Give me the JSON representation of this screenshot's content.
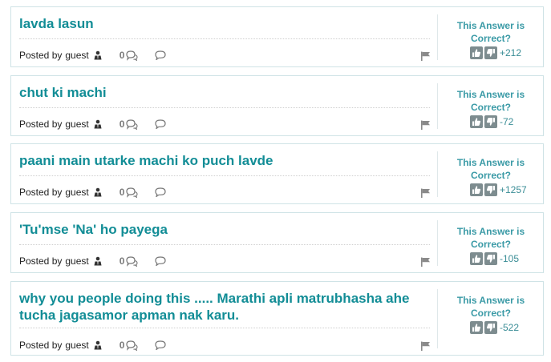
{
  "answers": [
    {
      "text": "lavda lasun",
      "posted_by": "Posted by",
      "author": "guest",
      "comments": "0",
      "vote_prompt": "This Answer is Correct?",
      "score": "+212"
    },
    {
      "text": "chut ki machi",
      "posted_by": "Posted by",
      "author": "guest",
      "comments": "0",
      "vote_prompt": "This Answer is Correct?",
      "score": "-72"
    },
    {
      "text": "paani main utarke machi ko puch lavde",
      "posted_by": "Posted by",
      "author": "guest",
      "comments": "0",
      "vote_prompt": "This Answer is Correct?",
      "score": "+1257"
    },
    {
      "text": "'Tu'mse 'Na' ho payega",
      "posted_by": "Posted by",
      "author": "guest",
      "comments": "0",
      "vote_prompt": "This Answer is Correct?",
      "score": "-105"
    },
    {
      "text": "why you people doing this ..... Marathi apli matrubhasha ahe tucha jagasamor apman nak karu.",
      "posted_by": "Posted by",
      "author": "guest",
      "comments": "0",
      "vote_prompt": "This Answer is Correct?",
      "score": "-522"
    }
  ],
  "icons": {
    "user": "user-icon",
    "comments": "comments-icon",
    "reply": "reply-icon",
    "flag": "flag-icon",
    "thumbs_up": "thumbs-up-icon",
    "thumbs_down": "thumbs-down-icon"
  },
  "colors": {
    "title": "#128d96",
    "vote_prompt": "#3a9aa6",
    "card_border": "#cfe3e6",
    "thumb": "#7d8c8f"
  }
}
